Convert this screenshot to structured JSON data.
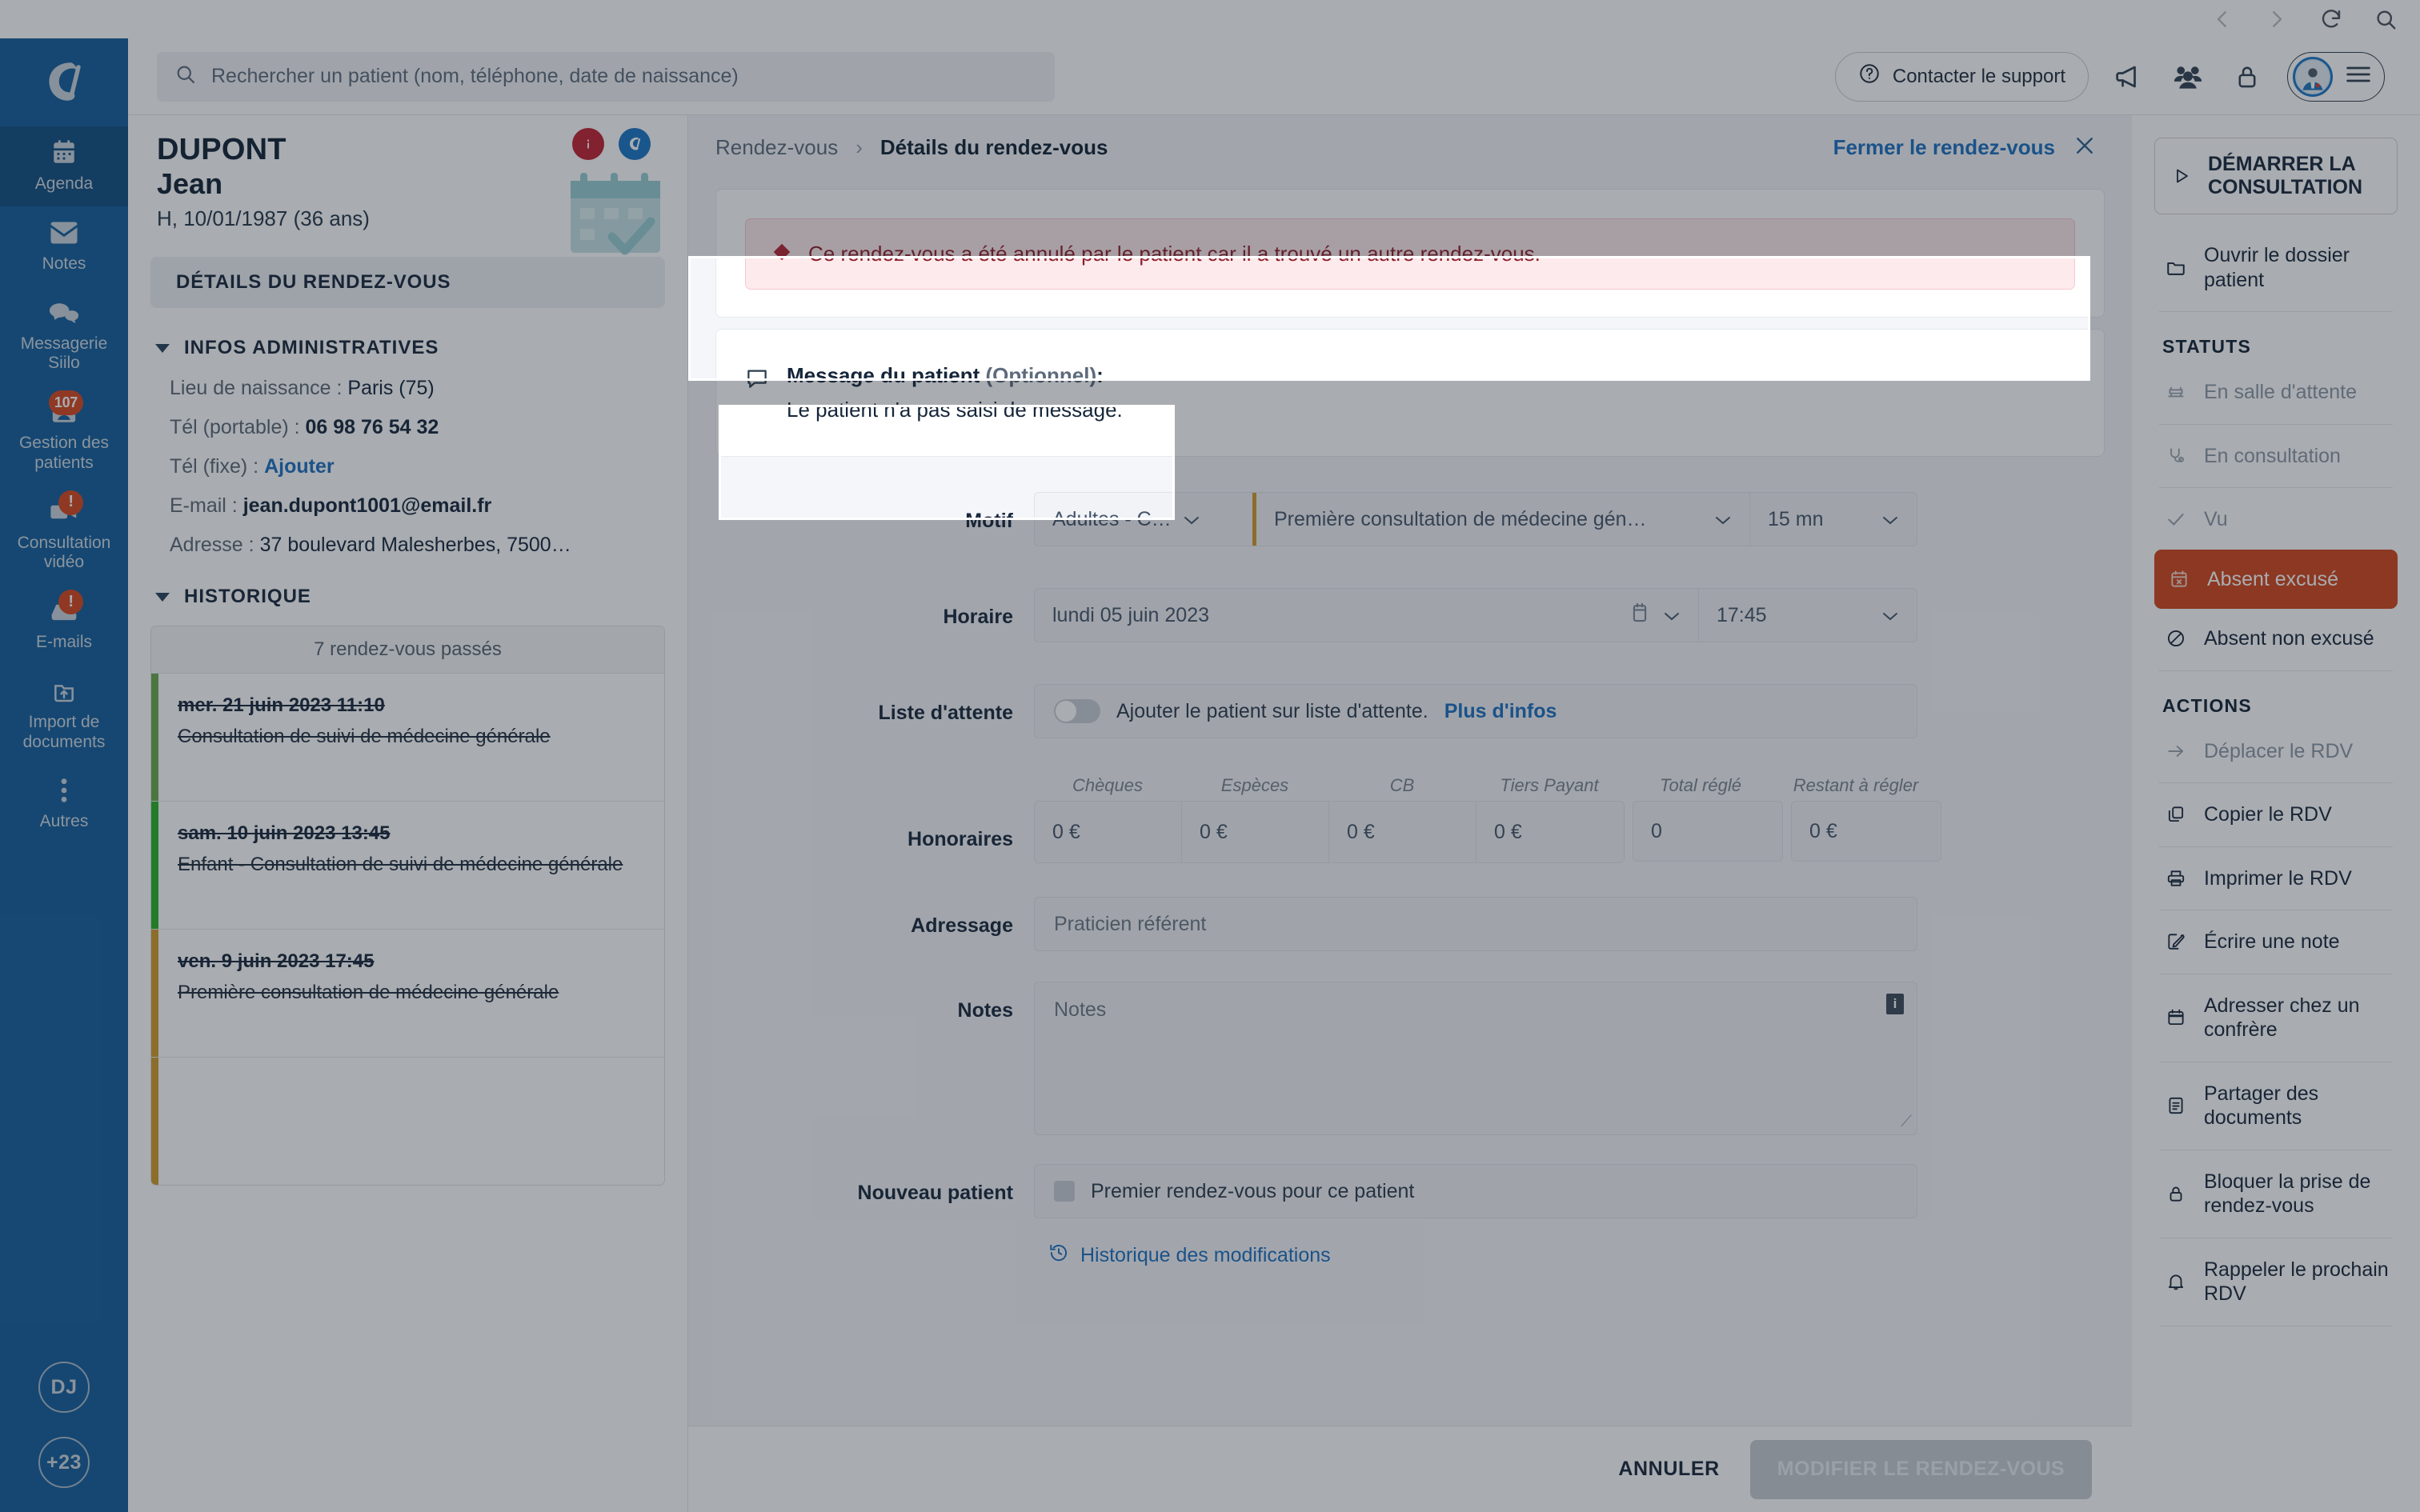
{
  "browser": {
    "back": "back-arrow",
    "forward": "forward-arrow",
    "reload": "reload-icon",
    "find": "search-icon"
  },
  "rail": {
    "logo": "doctolib-logo",
    "items": [
      {
        "label": "Agenda",
        "icon": "calendar-icon",
        "active": true,
        "badge": ""
      },
      {
        "label": "Notes",
        "icon": "envelope-icon",
        "active": false,
        "badge": ""
      },
      {
        "label": "Messagerie Siilo",
        "icon": "chat-bubbles-icon",
        "active": false,
        "badge": ""
      },
      {
        "label": "Gestion des patients",
        "icon": "patient-folder-icon",
        "active": false,
        "badge": "107"
      },
      {
        "label": "Consultation vidéo",
        "icon": "video-card-icon",
        "active": false,
        "badge": "!"
      },
      {
        "label": "E-mails",
        "icon": "mail-tray-icon",
        "active": false,
        "badge": "!"
      },
      {
        "label": "Import de documents",
        "icon": "upload-document-icon",
        "active": false,
        "badge": ""
      },
      {
        "label": "Autres",
        "icon": "more-dots-icon",
        "active": false,
        "badge": ""
      }
    ],
    "avatars": [
      {
        "label": "DJ"
      },
      {
        "label": "+23"
      }
    ]
  },
  "topbar": {
    "search_placeholder": "Rechercher un patient (nom, téléphone, date de naissance)",
    "search_value": "",
    "support_label": "Contacter le support",
    "icons": [
      "megaphone-icon",
      "team-icon",
      "lock-icon",
      "hamburger-icon"
    ]
  },
  "patient": {
    "last_name": "DUPONT",
    "first_name": "Jean",
    "meta": "H, 10/01/1987 (36 ans)",
    "tab_label": "DÉTAILS DU RENDEZ-VOUS",
    "sections": {
      "admin_title": "INFOS ADMINISTRATIVES",
      "history_title": "HISTORIQUE"
    },
    "fields": [
      {
        "label": "Lieu de naissance :",
        "value": "Paris (75)",
        "bold": false,
        "link": false
      },
      {
        "label": "Tél (portable) :",
        "value": "06 98 76 54 32",
        "bold": true,
        "link": false
      },
      {
        "label": "Tél (fixe) :",
        "value": "Ajouter",
        "bold": false,
        "link": true
      },
      {
        "label": "E-mail :",
        "value": "jean.dupont1001@email.fr",
        "bold": true,
        "link": false
      },
      {
        "label": "Adresse :",
        "value": "37 boulevard Malesherbes, 7500…",
        "bold": false,
        "link": false
      }
    ],
    "history_header": "7 rendez-vous passés",
    "history": [
      {
        "date": "mer. 21 juin 2023 11:10",
        "desc": "Consultation de suivi de médecine générale",
        "color": "#6aa64b"
      },
      {
        "date": "sam. 10 juin 2023 13:45",
        "desc": "Enfant - Consultation de suivi de médecine générale",
        "color": "#27b024"
      },
      {
        "date": "ven. 9 juin 2023 17:45",
        "desc": "Première consultation de médecine générale",
        "color": "#d09a27"
      },
      {
        "date": "",
        "desc": "",
        "color": "#d09a27"
      }
    ]
  },
  "breadcrumb": {
    "parent": "Rendez-vous",
    "separator": "›",
    "current": "Détails du rendez-vous",
    "close_label": "Fermer le rendez-vous",
    "close_icon": "close-icon"
  },
  "alert": {
    "icon": "alert-diamond-icon",
    "text": "Ce rendez-vous a été annulé par le patient car il a trouvé un autre rendez-vous."
  },
  "patient_message": {
    "icon": "speech-bubble-icon",
    "title": "Message du patient",
    "optional": "(Optionnel)",
    "colon": ":",
    "body": "Le patient n'a pas saisi de message."
  },
  "form": {
    "motif": {
      "label": "Motif",
      "category": "Adultes - C…",
      "reason": "Première consultation de médecine gén…",
      "duration": "15 mn"
    },
    "horaire": {
      "label": "Horaire",
      "date": "lundi 05 juin 2023",
      "time": "17:45",
      "calendar_icon": "calendar-small-icon"
    },
    "waitlist": {
      "label": "Liste d'attente",
      "text": "Ajouter le patient sur liste d'attente.",
      "link": "Plus d'infos",
      "enabled": false
    },
    "honoraires": {
      "label": "Honoraires",
      "columns": [
        "Chèques",
        "Espèces",
        "CB",
        "Tiers Payant",
        "Total réglé",
        "Restant à régler"
      ],
      "values": [
        "0 €",
        "0 €",
        "0 €",
        "0 €",
        "0",
        "0 €"
      ]
    },
    "adressage": {
      "label": "Adressage",
      "placeholder": "Praticien référent",
      "value": ""
    },
    "notes": {
      "label": "Notes",
      "placeholder": "Notes",
      "value": "",
      "info_icon": "info-icon"
    },
    "nouveau_patient": {
      "label": "Nouveau patient",
      "text": "Premier rendez-vous pour ce patient",
      "checked": false
    },
    "history_link": {
      "icon": "history-clock-icon",
      "label": "Historique des modifications"
    }
  },
  "footer": {
    "cancel": "ANNULER",
    "submit": "MODIFIER LE RENDEZ-VOUS"
  },
  "right_panel": {
    "start_consultation": "DÉMARRER LA CONSULTATION",
    "start_icon": "play-icon",
    "open_file": "Ouvrir le dossier patient",
    "open_file_icon": "folder-icon",
    "statuses_title": "STATUTS",
    "statuses": [
      {
        "label": "En salle d'attente",
        "icon": "waiting-chair-icon",
        "state": "muted"
      },
      {
        "label": "En consultation",
        "icon": "stethoscope-icon",
        "state": "muted"
      },
      {
        "label": "Vu",
        "icon": "check-icon",
        "state": "muted"
      },
      {
        "label": "Absent excusé",
        "icon": "calendar-x-icon",
        "state": "selected"
      },
      {
        "label": "Absent non excusé",
        "icon": "no-entry-icon",
        "state": "normal"
      }
    ],
    "actions_title": "ACTIONS",
    "actions": [
      {
        "label": "Déplacer le RDV",
        "icon": "arrow-right-icon",
        "state": "muted"
      },
      {
        "label": "Copier le RDV",
        "icon": "copy-icon",
        "state": "normal"
      },
      {
        "label": "Imprimer le RDV",
        "icon": "printer-icon",
        "state": "normal"
      },
      {
        "label": "Écrire une note",
        "icon": "pencil-square-icon",
        "state": "normal"
      },
      {
        "label": "Adresser chez un confrère",
        "icon": "calendar-icon",
        "state": "normal"
      },
      {
        "label": "Partager des documents",
        "icon": "document-icon",
        "state": "normal"
      },
      {
        "label": "Bloquer la prise de rendez-vous",
        "icon": "lock-icon",
        "state": "normal"
      },
      {
        "label": "Rappeler le prochain RDV",
        "icon": "bell-icon",
        "state": "normal"
      }
    ]
  },
  "colors": {
    "brand_blue": "#115d9c",
    "link_blue": "#1a6fc0",
    "selected_orange": "#d1451b",
    "badge_red": "#d6461e",
    "alert_bg": "#fdeaec",
    "alert_text": "#8f1d2a"
  }
}
